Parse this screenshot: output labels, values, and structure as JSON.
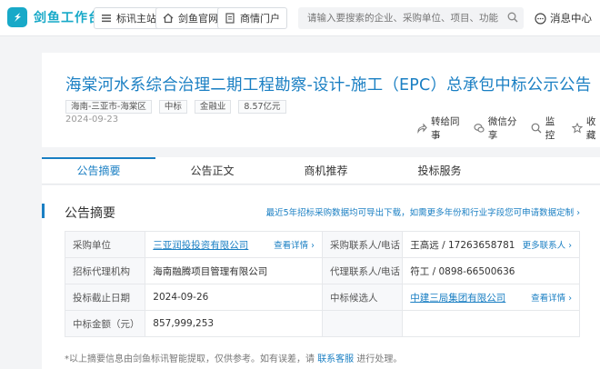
{
  "header": {
    "logo_mark": "S",
    "logo_text": "剑鱼工作台",
    "nav": [
      {
        "label": "标讯主站",
        "icon": "list-icon"
      },
      {
        "label": "剑鱼官网",
        "icon": "home-icon"
      },
      {
        "label": "商情门户",
        "icon": "document-icon"
      }
    ],
    "search_placeholder": "请输入要搜索的企业、采购单位、项目、功能名称",
    "messages_label": "消息中心"
  },
  "notice": {
    "title": "海棠河水系综合治理二期工程勘察-设计-施工（EPC）总承包中标公示公告",
    "tags": [
      "海南-三亚市-海棠区",
      "中标",
      "金融业",
      "8.57亿元"
    ],
    "date": "2024-09-23",
    "actions": [
      {
        "label": "转给同事",
        "icon": "share-icon"
      },
      {
        "label": "微信分享",
        "icon": "wechat-icon"
      },
      {
        "label": "监控",
        "icon": "monitor-icon"
      },
      {
        "label": "收藏",
        "icon": "star-icon"
      }
    ]
  },
  "tabs": [
    {
      "label": "公告摘要",
      "active": true
    },
    {
      "label": "公告正文",
      "active": false
    },
    {
      "label": "商机推荐",
      "active": false
    },
    {
      "label": "投标服务",
      "active": false
    }
  ],
  "summary": {
    "title": "公告摘要",
    "export_text": "最近5年招标采购数据均可导出下载，如需更多年份和行业字段您可申请数据定制 ›",
    "rows": [
      {
        "l1": "采购单位",
        "v1": "三亚润投投资有限公司",
        "v1_link": true,
        "m1": "查看详情 ›",
        "l2": "采购联系人/电话",
        "v2": "王高远 / 17263658781",
        "v2_link": false,
        "m2": "更多联系人 ›"
      },
      {
        "l1": "招标代理机构",
        "v1": "海南融腾项目管理有限公司",
        "v1_link": false,
        "m1": "",
        "l2": "代理联系人/电话",
        "v2": "符工 / 0898-66500636",
        "v2_link": false,
        "m2": ""
      },
      {
        "l1": "投标截止日期",
        "v1": "2024-09-26",
        "v1_link": false,
        "m1": "",
        "l2": "中标候选人",
        "v2": "中建三局集团有限公司",
        "v2_link": true,
        "m2": "查看详情 ›"
      },
      {
        "l1": "中标金额（元）",
        "v1": "857,999,253",
        "v1_link": false,
        "m1": "",
        "l2": "",
        "v2": "",
        "v2_link": false,
        "m2": ""
      }
    ],
    "note_prefix": "*以上摘要信息由剑鱼标讯智能提取，仅供参考。如有误差，请",
    "note_link": "联系客服",
    "note_suffix": "进行处理。"
  }
}
